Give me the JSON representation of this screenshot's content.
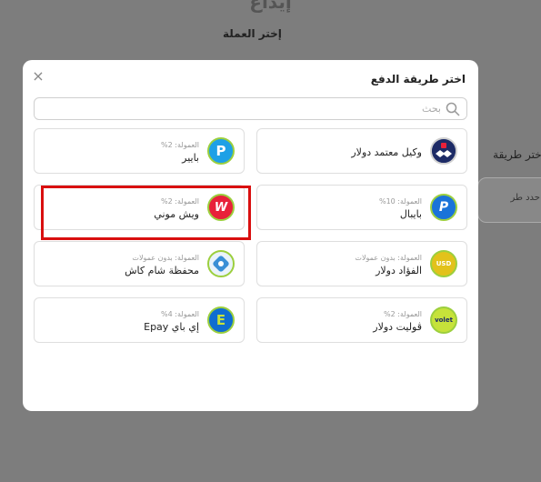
{
  "background": {
    "page_title": "إيداع",
    "currency_label": "إختر العملة",
    "method_label": "إختر طريقة",
    "method_placeholder": "حدد طر"
  },
  "modal": {
    "title": "اختر طريقة الدفع",
    "close_symbol": "×",
    "search_placeholder": "بحث",
    "methods": [
      {
        "name": "وكيل معتمد دولار",
        "commission": "",
        "icon": "handshake-agent-icon"
      },
      {
        "name": "بايير",
        "commission": "العمولة: 2%",
        "icon": "payeer-icon",
        "logo_text": "P"
      },
      {
        "name": "بايبال",
        "commission": "العمولة: 10%",
        "icon": "paypal-icon",
        "logo_text": "P"
      },
      {
        "name": "ويش موني",
        "commission": "العمولة: 2%",
        "icon": "wishmoney-icon",
        "logo_text": "W"
      },
      {
        "name": "الفؤاد دولار",
        "commission": "العمولة: بدون عمولات",
        "icon": "alfouad-icon",
        "logo_text": "USD"
      },
      {
        "name": "محفظة شام كاش",
        "commission": "العمولة: بدون عمولات",
        "icon": "shamcash-icon"
      },
      {
        "name": "ڤوليت دولار",
        "commission": "العمولة: 2%",
        "icon": "volet-icon",
        "logo_text": "volet"
      },
      {
        "name": "إي باي Epay",
        "commission": "العمولة: 4%",
        "icon": "epay-icon",
        "logo_text": "E"
      }
    ]
  },
  "colors": {
    "overlay": "#7d7d7d",
    "logo_ring": "#9ccf3e",
    "highlight": "#d90f0f",
    "payeer": "#1ea0e6",
    "paypal": "#1a73d9",
    "wishmoney": "#e8213a",
    "alfouad": "#e2c21b",
    "volet": "#c6e23a",
    "epay": "#0f6dd1",
    "shamcash": "#3a8fd6"
  }
}
